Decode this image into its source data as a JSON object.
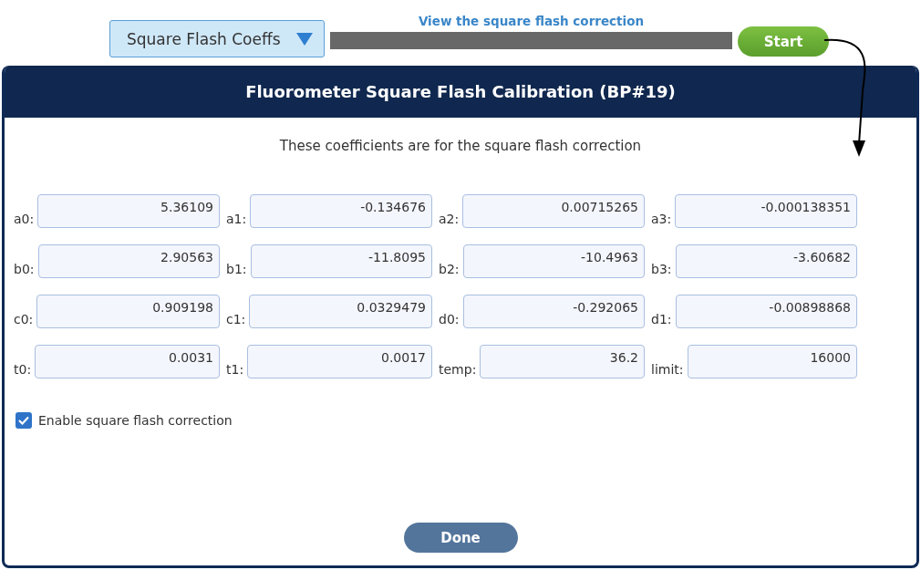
{
  "toolbar": {
    "dropdown": {
      "value": "Square Flash Coeffs"
    },
    "link": "View the square flash correction",
    "start_button": "Start"
  },
  "dialog": {
    "title": "Fluorometer Square Flash Calibration (BP#19)",
    "subtitle": "These coefficients are for the square flash correction",
    "fields": [
      [
        {
          "label": "a0:",
          "value": "5.36109"
        },
        {
          "label": "a1:",
          "value": "-0.134676"
        },
        {
          "label": "a2:",
          "value": "0.00715265"
        },
        {
          "label": "a3:",
          "value": "-0.000138351"
        }
      ],
      [
        {
          "label": "b0:",
          "value": "2.90563"
        },
        {
          "label": "b1:",
          "value": "-11.8095"
        },
        {
          "label": "b2:",
          "value": "-10.4963"
        },
        {
          "label": "b3:",
          "value": "-3.60682"
        }
      ],
      [
        {
          "label": "c0:",
          "value": "0.909198"
        },
        {
          "label": "c1:",
          "value": "0.0329479"
        },
        {
          "label": "d0:",
          "value": "-0.292065"
        },
        {
          "label": "d1:",
          "value": "-0.00898868"
        }
      ],
      [
        {
          "label": "t0:",
          "value": "0.0031"
        },
        {
          "label": "t1:",
          "value": "0.0017"
        },
        {
          "label": "temp:",
          "value": "36.2"
        },
        {
          "label": "limit:",
          "value": "16000"
        }
      ]
    ],
    "checkbox": {
      "label": "Enable square flash correction",
      "checked": true
    },
    "done_button": "Done"
  }
}
